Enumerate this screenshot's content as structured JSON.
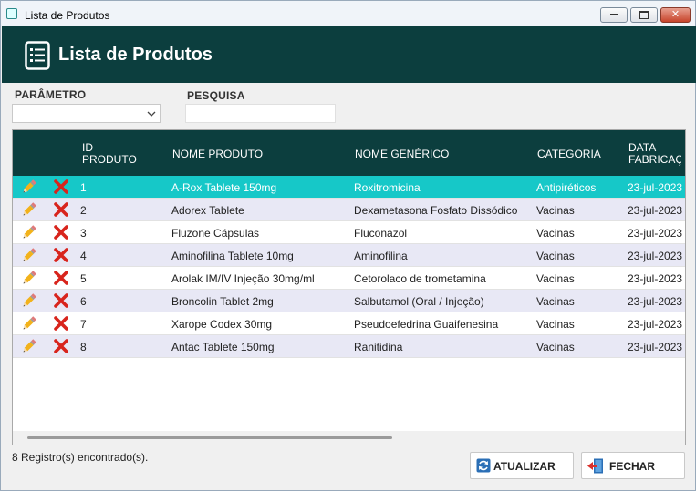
{
  "window": {
    "title": "Lista de Produtos"
  },
  "header": {
    "title": "Lista de Produtos",
    "icon": "list-document-icon"
  },
  "filters": {
    "param_label": "PARÂMETRO",
    "param_value": "",
    "search_label": "PESQUISA",
    "search_value": ""
  },
  "table": {
    "columns": [
      "ID PRODUTO",
      "NOME PRODUTO",
      "NOME GENÉRICO",
      "CATEGORIA",
      "DATA FABRICAÇÃO"
    ],
    "rows": [
      {
        "id": "1",
        "nome": "A-Rox Tablete 150mg",
        "generico": "Roxitromicina",
        "categoria": "Antipiréticos",
        "data": "23-jul-2023"
      },
      {
        "id": "2",
        "nome": "Adorex Tablete",
        "generico": "Dexametasona Fosfato Dissódico",
        "categoria": "Vacinas",
        "data": "23-jul-2023"
      },
      {
        "id": "3",
        "nome": "Fluzone Cápsulas",
        "generico": "Fluconazol",
        "categoria": "Vacinas",
        "data": "23-jul-2023"
      },
      {
        "id": "4",
        "nome": "Aminofilina Tablete 10mg",
        "generico": "Aminofilina",
        "categoria": "Vacinas",
        "data": "23-jul-2023"
      },
      {
        "id": "5",
        "nome": "Arolak IM/IV Injeção 30mg/ml",
        "generico": "Cetorolaco de trometamina",
        "categoria": "Vacinas",
        "data": "23-jul-2023"
      },
      {
        "id": "6",
        "nome": "Broncolin Tablet 2mg",
        "generico": "Salbutamol (Oral / Injeção)",
        "categoria": "Vacinas",
        "data": "23-jul-2023"
      },
      {
        "id": "7",
        "nome": "Xarope Codex 30mg",
        "generico": "Pseudoefedrina Guaifenesina",
        "categoria": "Vacinas",
        "data": "23-jul-2023"
      },
      {
        "id": "8",
        "nome": "Antac Tablete 150mg",
        "generico": "Ranitidina",
        "categoria": "Vacinas",
        "data": "23-jul-2023"
      }
    ],
    "selected_row": 0
  },
  "status": {
    "text": "8 Registro(s) encontrado(s)."
  },
  "buttons": {
    "refresh_label": "ATUALIZAR",
    "close_label": "FECHAR"
  },
  "colors": {
    "header": "#0c3e3e",
    "selected_row": "#16c8c8",
    "alt_row": "#e8e8f5"
  }
}
